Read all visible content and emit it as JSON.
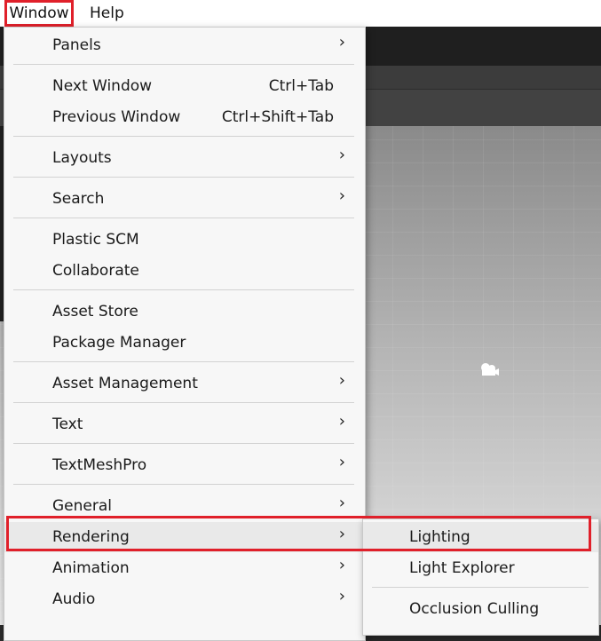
{
  "menubar": {
    "window_label": "Window",
    "help_label": "Help"
  },
  "window_menu": {
    "items": [
      {
        "label": "Panels",
        "shortcut": "",
        "arrow": "›"
      },
      {
        "label": "Next Window",
        "shortcut": "Ctrl+Tab",
        "arrow": ""
      },
      {
        "label": "Previous Window",
        "shortcut": "Ctrl+Shift+Tab",
        "arrow": ""
      },
      {
        "label": "Layouts",
        "shortcut": "",
        "arrow": "›"
      },
      {
        "label": "Search",
        "shortcut": "",
        "arrow": "›"
      },
      {
        "label": "Plastic SCM",
        "shortcut": "",
        "arrow": ""
      },
      {
        "label": "Collaborate",
        "shortcut": "",
        "arrow": ""
      },
      {
        "label": "Asset Store",
        "shortcut": "",
        "arrow": ""
      },
      {
        "label": "Package Manager",
        "shortcut": "",
        "arrow": ""
      },
      {
        "label": "Asset Management",
        "shortcut": "",
        "arrow": "›"
      },
      {
        "label": "Text",
        "shortcut": "",
        "arrow": "›"
      },
      {
        "label": "TextMeshPro",
        "shortcut": "",
        "arrow": "›"
      },
      {
        "label": "General",
        "shortcut": "",
        "arrow": "›"
      },
      {
        "label": "Rendering",
        "shortcut": "",
        "arrow": "›"
      },
      {
        "label": "Animation",
        "shortcut": "",
        "arrow": "›"
      },
      {
        "label": "Audio",
        "shortcut": "",
        "arrow": "›"
      }
    ]
  },
  "rendering_submenu": {
    "items": [
      {
        "label": "Lighting"
      },
      {
        "label": "Light Explorer"
      },
      {
        "label": "Occlusion Culling"
      }
    ]
  },
  "colors": {
    "highlight": "#e0202a",
    "menu_bg": "#f7f7f7"
  }
}
